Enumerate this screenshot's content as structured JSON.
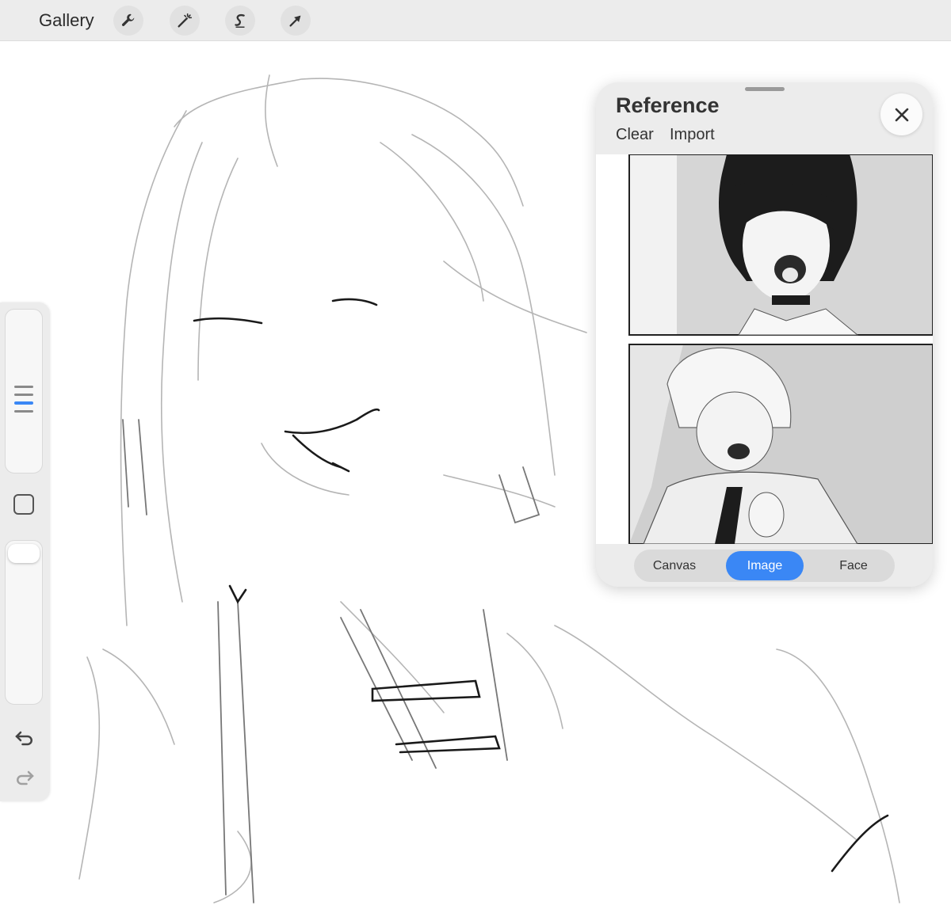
{
  "topbar": {
    "gallery_label": "Gallery",
    "tools": [
      {
        "icon": "wrench-icon",
        "name": "actions"
      },
      {
        "icon": "magic-wand-icon",
        "name": "adjustments"
      },
      {
        "icon": "selection-s-icon",
        "name": "selection"
      },
      {
        "icon": "arrow-cursor-icon",
        "name": "transform"
      }
    ]
  },
  "sidebar": {
    "brush_size_level": 0.6,
    "opacity_level": 1.0
  },
  "reference": {
    "title": "Reference",
    "clear_label": "Clear",
    "import_label": "Import",
    "close_icon": "close-icon",
    "tabs": [
      {
        "label": "Canvas",
        "active": false
      },
      {
        "label": "Image",
        "active": true
      },
      {
        "label": "Face",
        "active": false
      }
    ]
  },
  "colors": {
    "toolbar_bg": "#ececec",
    "accent": "#3a87f5",
    "canvas": "#ffffff"
  }
}
